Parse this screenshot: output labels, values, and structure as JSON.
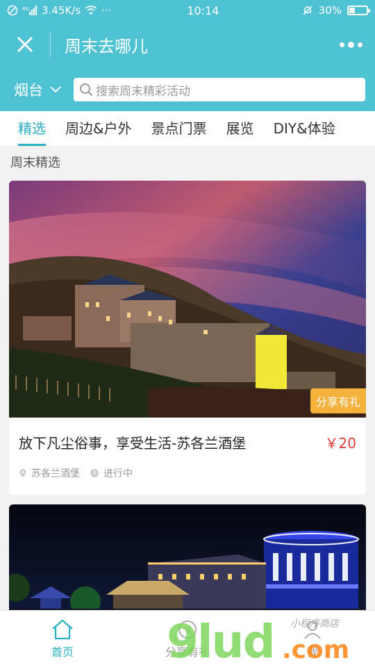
{
  "status_bar": {
    "network": "3.45K/s",
    "time": "10:14",
    "battery": "30%",
    "more": "···"
  },
  "header": {
    "title": "周末去哪儿",
    "close_icon": "close-icon",
    "more_icon": "more-dots-icon"
  },
  "search": {
    "city": "烟台",
    "placeholder": "搜索周末精彩活动"
  },
  "tabs": [
    {
      "label": "精选",
      "active": true
    },
    {
      "label": "周边&户外",
      "active": false
    },
    {
      "label": "景点门票",
      "active": false
    },
    {
      "label": "展览",
      "active": false
    },
    {
      "label": "DIY&体验",
      "active": false
    }
  ],
  "section_title": "周末精选",
  "cards": [
    {
      "title": "放下凡尘俗事，享受生活-苏各兰酒堡",
      "price": "￥20",
      "badge": "分享有礼",
      "location": "苏各兰酒堡",
      "status": "进行中"
    },
    {
      "title": "",
      "price": ""
    }
  ],
  "bottom_nav": [
    {
      "label": "首页",
      "icon": "home-icon",
      "active": true
    },
    {
      "label": "分享有礼",
      "icon": "gift-icon",
      "active": false
    },
    {
      "label": "我",
      "icon": "user-icon",
      "active": false
    }
  ],
  "watermark": {
    "main": "9lud",
    "domain": ".com",
    "tag": "小程序商店"
  },
  "colors": {
    "brand": "#4ec1d2",
    "accent": "#2ab1c5",
    "price": "#e53935",
    "badge": "#f4b13c"
  }
}
